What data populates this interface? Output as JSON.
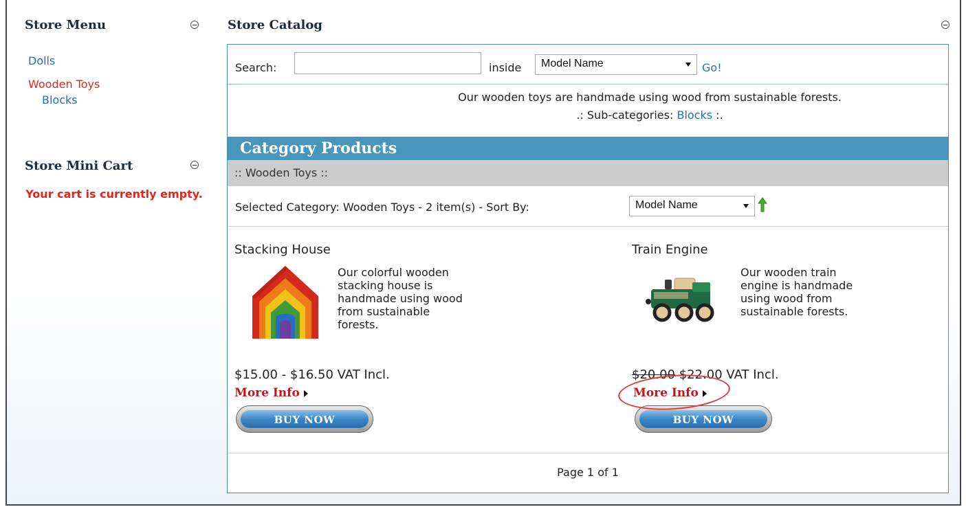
{
  "store_menu": {
    "title": "Store Menu",
    "items": [
      {
        "label": "Dolls"
      },
      {
        "label": "Wooden Toys"
      },
      {
        "label": "Blocks"
      }
    ]
  },
  "mini_cart": {
    "title": "Store Mini Cart",
    "empty_message": "Your cart is currently empty."
  },
  "catalog": {
    "title": "Store Catalog",
    "search": {
      "label": "Search:",
      "value": "",
      "inside_label": "inside",
      "field_selected": "Model Name",
      "go_label": "Go!"
    },
    "category_description": "Our wooden toys are handmade using wood from sustainable forests.",
    "subcategories_prefix": ".: Sub-categories:",
    "subcategory_link": "Blocks",
    "subcategories_suffix": ":.",
    "category_products_title": "Category Products",
    "breadcrumb": ":: Wooden Toys ::",
    "selected_category_text": "Selected Category: Wooden Toys - 2 item(s) - Sort By:",
    "sort_selected": "Model Name",
    "sort_icon": "green-up-arrow-icon",
    "products": [
      {
        "name": "Stacking House",
        "description": "Our colorful wooden stacking house is handmade using wood from sustainable forests.",
        "price": "$15.00 - $16.50 VAT Incl.",
        "more_info": "More Info",
        "buy_label": "BUY NOW"
      },
      {
        "name": "Train Engine",
        "description": "Our wooden train engine is handmade using wood from sustainable forests.",
        "price_old": "$20.00",
        "price_new": "$22.00 VAT Incl.",
        "more_info": "More Info",
        "buy_label": "BUY NOW"
      }
    ],
    "pager": "Page 1 of 1"
  },
  "colors": {
    "header_blue": "#4796bd",
    "link_blue": "#2a6ea6",
    "active_red": "#e8231c",
    "more_info_red": "#c0171c"
  }
}
